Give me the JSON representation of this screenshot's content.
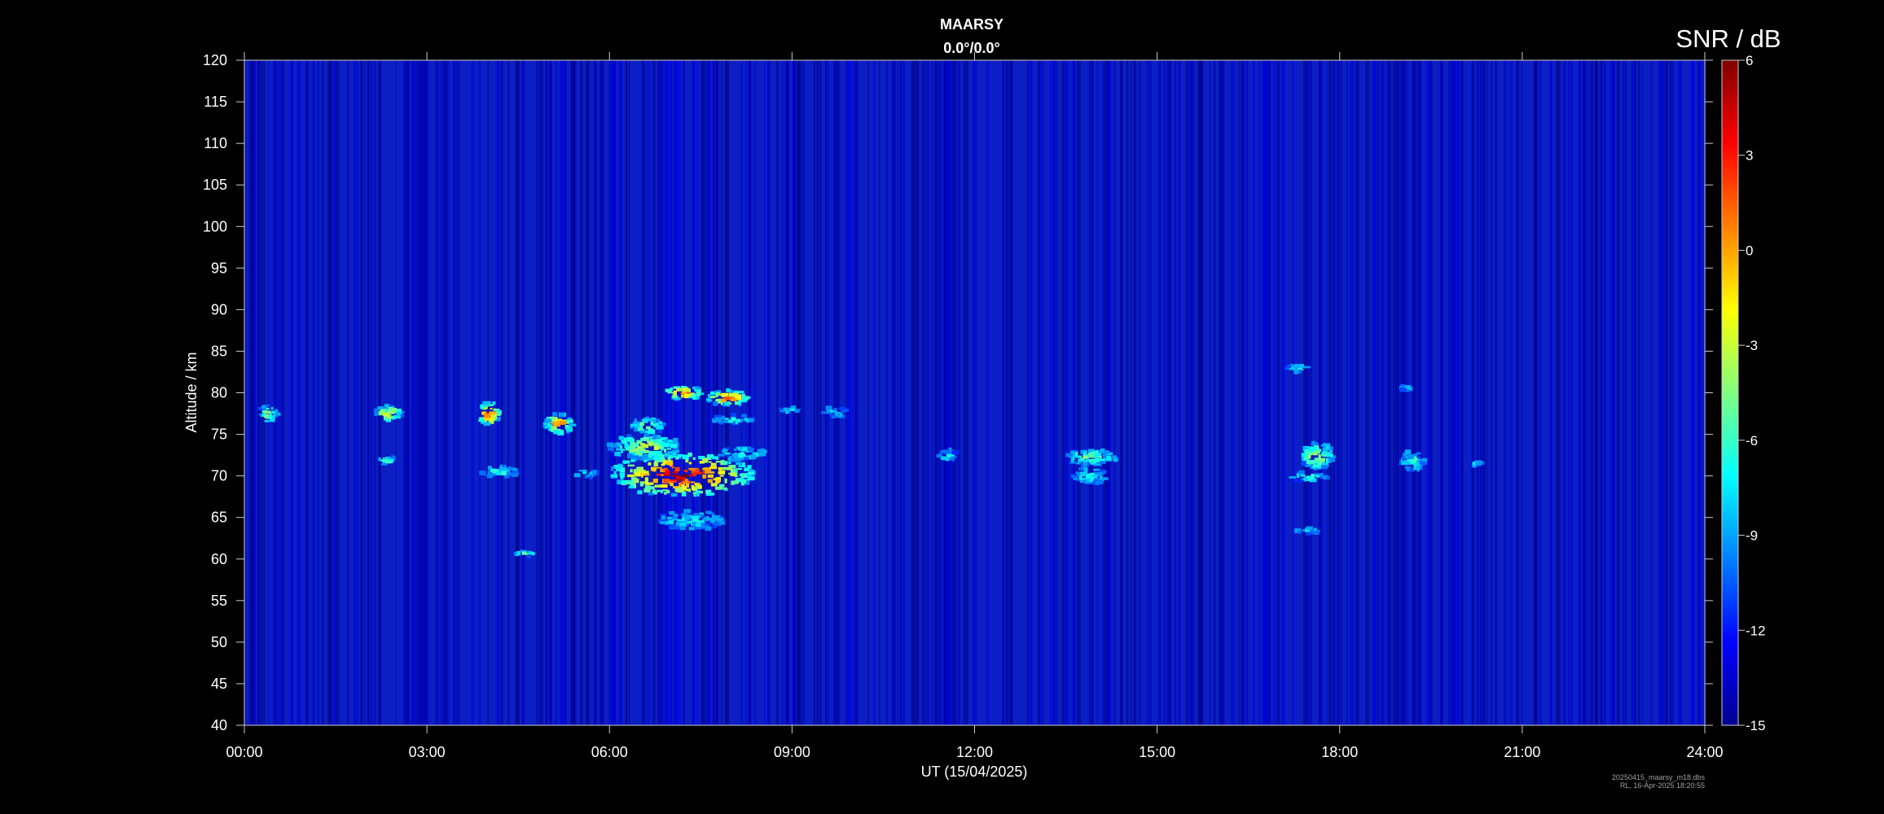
{
  "chart_data": {
    "type": "heatmap",
    "title": "MAARSY",
    "subtitle": "0.0°/0.0°",
    "xlabel": "UT (15/04/2025)",
    "ylabel": "Altitude / km",
    "xlim": [
      0,
      24
    ],
    "ylim": [
      40,
      120
    ],
    "x_tick_labels": [
      "00:00",
      "03:00",
      "06:00",
      "09:00",
      "12:00",
      "15:00",
      "18:00",
      "21:00",
      "24:00"
    ],
    "y_ticks": [
      40,
      45,
      50,
      55,
      60,
      65,
      70,
      75,
      80,
      85,
      90,
      95,
      100,
      105,
      110,
      115,
      120
    ],
    "colorbar": {
      "label": "SNR / dB",
      "range": [
        -15,
        6
      ],
      "ticks": [
        6,
        3,
        0,
        -3,
        -6,
        -9,
        -12,
        -15
      ],
      "colormap": "jet"
    },
    "background_level": -14,
    "echo_regions": [
      {
        "t0": 0.25,
        "t1": 0.55,
        "h0": 76.5,
        "h1": 78.5,
        "peak": -3
      },
      {
        "t0": 2.15,
        "t1": 2.6,
        "h0": 76.5,
        "h1": 78.5,
        "peak": -1
      },
      {
        "t0": 2.2,
        "t1": 2.55,
        "h0": 71.3,
        "h1": 72.3,
        "peak": -5
      },
      {
        "t0": 3.85,
        "t1": 4.2,
        "h0": 76.0,
        "h1": 79.0,
        "peak": 4
      },
      {
        "t0": 3.9,
        "t1": 4.5,
        "h0": 69.8,
        "h1": 71.2,
        "peak": -6
      },
      {
        "t0": 4.45,
        "t1": 4.8,
        "h0": 60.2,
        "h1": 61.0,
        "peak": -5
      },
      {
        "t0": 4.95,
        "t1": 5.4,
        "h0": 75.0,
        "h1": 77.5,
        "peak": 2
      },
      {
        "t0": 5.45,
        "t1": 5.8,
        "h0": 69.8,
        "h1": 70.8,
        "peak": -6
      },
      {
        "t0": 6.0,
        "t1": 7.2,
        "h0": 72.0,
        "h1": 75.0,
        "peak": -2
      },
      {
        "t0": 6.0,
        "t1": 8.4,
        "h0": 67.5,
        "h1": 72.8,
        "peak": 6
      },
      {
        "t0": 6.35,
        "t1": 6.9,
        "h0": 75.0,
        "h1": 77.0,
        "peak": -3
      },
      {
        "t0": 6.9,
        "t1": 7.55,
        "h0": 79.2,
        "h1": 80.8,
        "peak": 3
      },
      {
        "t0": 7.6,
        "t1": 8.3,
        "h0": 78.5,
        "h1": 80.3,
        "peak": 4
      },
      {
        "t0": 7.7,
        "t1": 8.4,
        "h0": 76.3,
        "h1": 77.3,
        "peak": -6
      },
      {
        "t0": 7.8,
        "t1": 8.6,
        "h0": 72.0,
        "h1": 73.5,
        "peak": -6
      },
      {
        "t0": 6.8,
        "t1": 7.9,
        "h0": 63.5,
        "h1": 65.8,
        "peak": -7
      },
      {
        "t0": 8.8,
        "t1": 9.1,
        "h0": 77.5,
        "h1": 78.4,
        "peak": -7
      },
      {
        "t0": 9.5,
        "t1": 9.95,
        "h0": 77.0,
        "h1": 78.3,
        "peak": -7
      },
      {
        "t0": 11.4,
        "t1": 11.7,
        "h0": 71.8,
        "h1": 73.2,
        "peak": -7
      },
      {
        "t0": 13.45,
        "t1": 14.35,
        "h0": 71.3,
        "h1": 73.2,
        "peak": -4
      },
      {
        "t0": 13.6,
        "t1": 14.2,
        "h0": 69.0,
        "h1": 71.0,
        "peak": -7
      },
      {
        "t0": 17.35,
        "t1": 17.9,
        "h0": 70.8,
        "h1": 74.0,
        "peak": -2
      },
      {
        "t0": 17.2,
        "t1": 17.8,
        "h0": 69.3,
        "h1": 70.5,
        "peak": -6
      },
      {
        "t0": 17.3,
        "t1": 17.7,
        "h0": 63.0,
        "h1": 63.8,
        "peak": -8
      },
      {
        "t0": 17.1,
        "t1": 17.5,
        "h0": 82.5,
        "h1": 83.4,
        "peak": -7
      },
      {
        "t0": 19.0,
        "t1": 19.25,
        "h0": 80.2,
        "h1": 81.2,
        "peak": -7
      },
      {
        "t0": 19.0,
        "t1": 19.4,
        "h0": 70.5,
        "h1": 73.0,
        "peak": -6
      },
      {
        "t0": 20.15,
        "t1": 20.35,
        "h0": 71.2,
        "h1": 71.9,
        "peak": -7
      }
    ]
  },
  "footer": {
    "file_line": "20250415_maarsy_m18.dbs",
    "stamp_line": "RL, 16-Apr-2025 18:20:55"
  }
}
